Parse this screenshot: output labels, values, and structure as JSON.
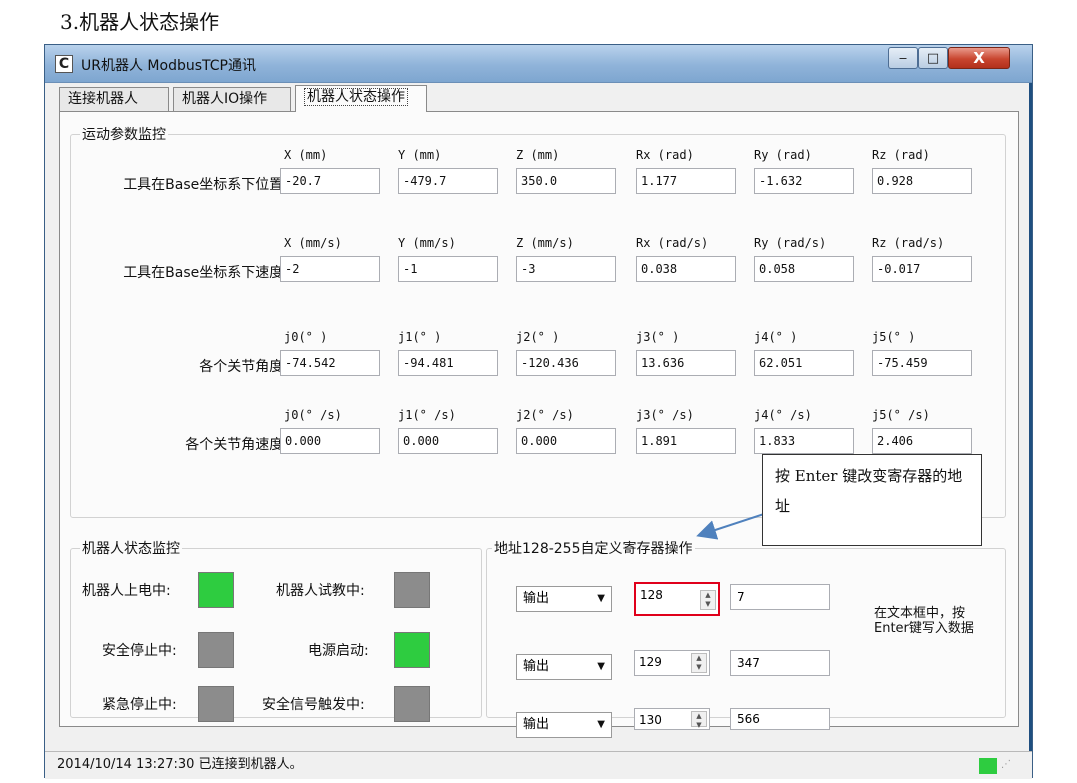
{
  "doc_heading": "3.机器人状态操作",
  "window": {
    "title": "UR机器人 ModbusTCP通讯",
    "icon_glyph": "C",
    "min_glyph": "‒",
    "max_glyph": "□",
    "close_glyph": "X"
  },
  "tabs": [
    {
      "label": "连接机器人"
    },
    {
      "label": "机器人IO操作"
    },
    {
      "label": "机器人状态操作"
    }
  ],
  "motion_monitor": {
    "title": "运动参数监控",
    "rows": [
      {
        "label": "工具在Base坐标系下位置:",
        "headers": [
          "X (mm)",
          "Y (mm)",
          "Z (mm)",
          "Rx (rad)",
          "Ry (rad)",
          "Rz (rad)"
        ],
        "values": [
          "-20.7",
          "-479.7",
          "350.0",
          "1.177",
          "-1.632",
          "0.928"
        ]
      },
      {
        "label": "工具在Base坐标系下速度:",
        "headers": [
          "X (mm/s)",
          "Y (mm/s)",
          "Z (mm/s)",
          "Rx (rad/s)",
          "Ry (rad/s)",
          "Rz (rad/s)"
        ],
        "values": [
          "-2",
          "-1",
          "-3",
          "0.038",
          "0.058",
          "-0.017"
        ]
      },
      {
        "label": "各个关节角度:",
        "headers": [
          "j0(° )",
          "j1(° )",
          "j2(° )",
          "j3(° )",
          "j4(° )",
          "j5(° )"
        ],
        "values": [
          "-74.542",
          "-94.481",
          "-120.436",
          "13.636",
          "62.051",
          "-75.459"
        ]
      },
      {
        "label": "各个关节角速度:",
        "headers": [
          "j0(° /s)",
          "j1(° /s)",
          "j2(° /s)",
          "j3(° /s)",
          "j4(° /s)",
          "j5(° /s)"
        ],
        "values": [
          "0.000",
          "0.000",
          "0.000",
          "1.891",
          "1.833",
          "2.406"
        ]
      }
    ]
  },
  "status_monitor": {
    "title": "机器人状态监控",
    "items": [
      {
        "label": "机器人上电中:",
        "state": "on"
      },
      {
        "label": "机器人试教中:",
        "state": "off"
      },
      {
        "label": "安全停止中:",
        "state": "off"
      },
      {
        "label": "电源启动:",
        "state": "on"
      },
      {
        "label": "紧急停止中:",
        "state": "off"
      },
      {
        "label": "安全信号触发中:",
        "state": "off"
      }
    ],
    "colors": {
      "on": "#2ecc40",
      "off": "#8c8c8c"
    }
  },
  "registers": {
    "title": "地址128-255自定义寄存器操作",
    "rows": [
      {
        "mode": "输出",
        "address": "128",
        "value": "7"
      },
      {
        "mode": "输出",
        "address": "129",
        "value": "347"
      },
      {
        "mode": "输出",
        "address": "130",
        "value": "566"
      }
    ],
    "note": "在文本框中，按Enter键写入数据"
  },
  "callout_text": "按 Enter 键改变寄存器的地址",
  "statusbar": {
    "text": "2014/10/14 13:27:30  已连接到机器人。",
    "indicator_color": "#2ecc40"
  }
}
